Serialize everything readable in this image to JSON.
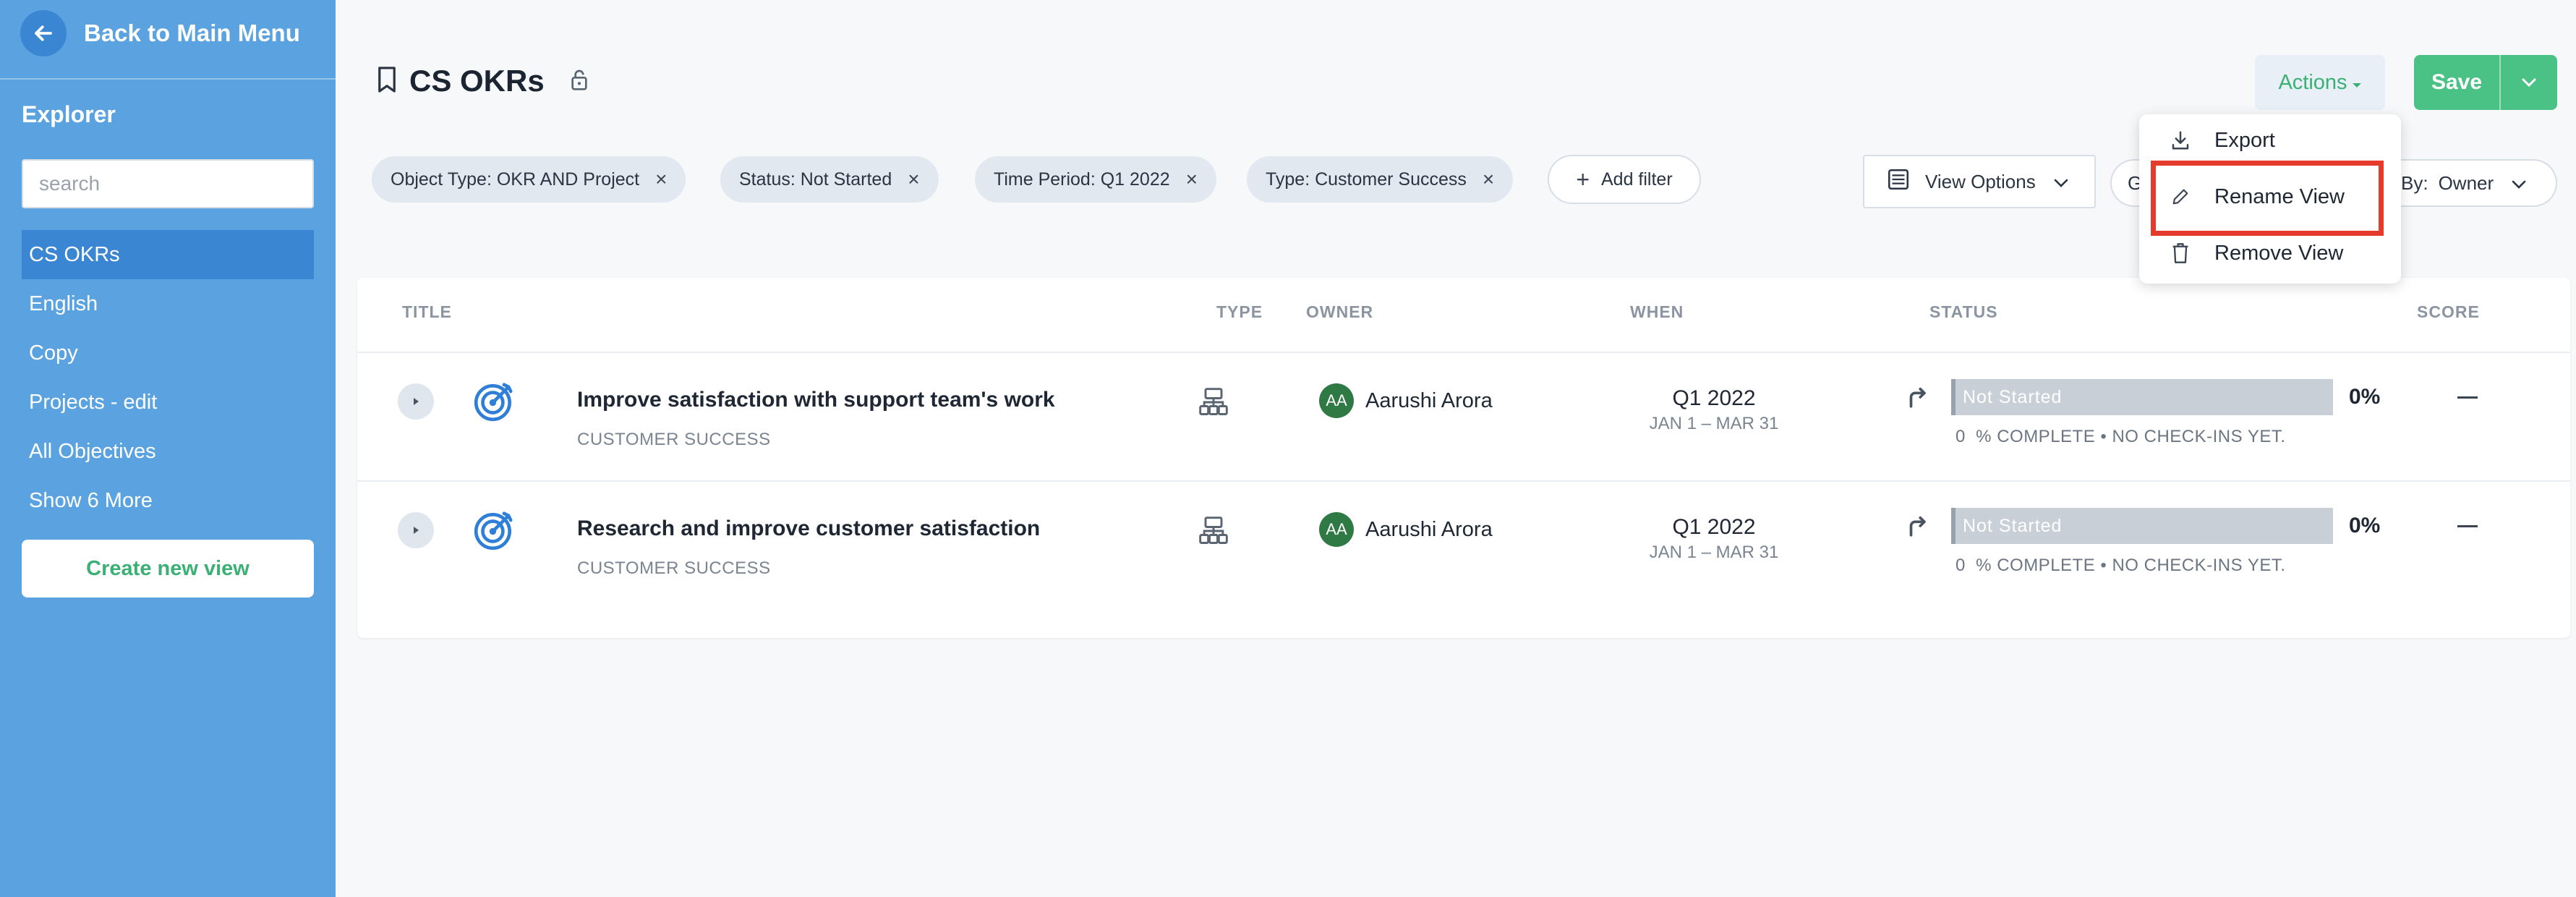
{
  "sidebar": {
    "back_label": "Back to Main Menu",
    "explorer_title": "Explorer",
    "search_placeholder": "search",
    "items": [
      {
        "label": "CS OKRs",
        "active": true
      },
      {
        "label": "English"
      },
      {
        "label": "Copy"
      },
      {
        "label": "Projects - edit"
      },
      {
        "label": "All Objectives"
      },
      {
        "label": "Show 6 More"
      }
    ],
    "create_label": "Create new view"
  },
  "header": {
    "title": "CS OKRs",
    "actions_label": "Actions",
    "save_label": "Save"
  },
  "filters": [
    {
      "label": "Object Type: OKR AND Project"
    },
    {
      "label": "Status: Not Started"
    },
    {
      "label": "Time Period: Q1 2022"
    },
    {
      "label": "Type: Customer Success"
    }
  ],
  "add_filter_label": "Add filter",
  "view_options_label": "View Options",
  "group_label": "G",
  "group_by_label": "By:",
  "group_by_value": "Owner",
  "table": {
    "columns": {
      "title": "TITLE",
      "type": "TYPE",
      "owner": "OWNER",
      "when": "WHEN",
      "status": "STATUS",
      "score": "SCORE"
    },
    "rows": [
      {
        "title": "Improve satisfaction with support team's work",
        "category": "CUSTOMER SUCCESS",
        "owner_initials": "AA",
        "owner_name": "Aarushi Arora",
        "period": "Q1 2022",
        "range": "JAN 1 – MAR 31",
        "status": "Not Started",
        "percent": "0%",
        "progress_note": "0  % COMPLETE • NO CHECK-INS YET."
      },
      {
        "title": "Research and improve customer satisfaction",
        "category": "CUSTOMER SUCCESS",
        "owner_initials": "AA",
        "owner_name": "Aarushi Arora",
        "period": "Q1 2022",
        "range": "JAN 1 – MAR 31",
        "status": "Not Started",
        "percent": "0%",
        "progress_note": "0  % COMPLETE • NO CHECK-INS YET."
      }
    ]
  },
  "actions_menu": {
    "export_label": "Export",
    "rename_label": "Rename View",
    "remove_label": "Remove View"
  },
  "colors": {
    "sidebar": "#5aa2e0",
    "accent_green": "#4bc285",
    "highlight": "#e53b2c",
    "goal_icon": "#2f7fd9"
  }
}
